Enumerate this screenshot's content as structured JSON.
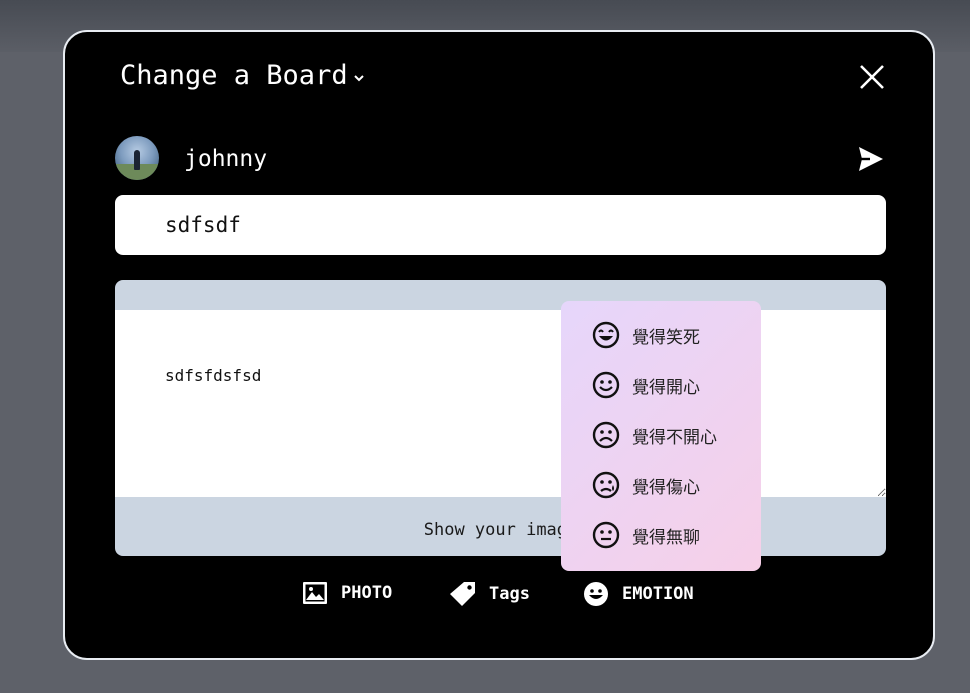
{
  "modal": {
    "title": "Change a Board",
    "username": "johnny",
    "title_value": "sdfsdf",
    "content_value": "sdfsfdsfsd",
    "upload_hint": "Show your image"
  },
  "toolbar": {
    "photo_label": "PHOTO",
    "tags_label": "Tags",
    "emotion_label": "EMOTION"
  },
  "emotion_menu": {
    "items": [
      {
        "label": "覺得笑死",
        "icon": "laughing-face-icon"
      },
      {
        "label": "覺得開心",
        "icon": "smile-face-icon"
      },
      {
        "label": "覺得不開心",
        "icon": "frown-face-icon"
      },
      {
        "label": "覺得傷心",
        "icon": "sad-tear-face-icon"
      },
      {
        "label": "覺得無聊",
        "icon": "neutral-face-icon"
      }
    ]
  },
  "colors": {
    "modal_background": "#000000",
    "content_header": "#cbd5e1",
    "menu_gradient_start": "#e6d6fb",
    "menu_gradient_end": "#f6d0e8"
  }
}
